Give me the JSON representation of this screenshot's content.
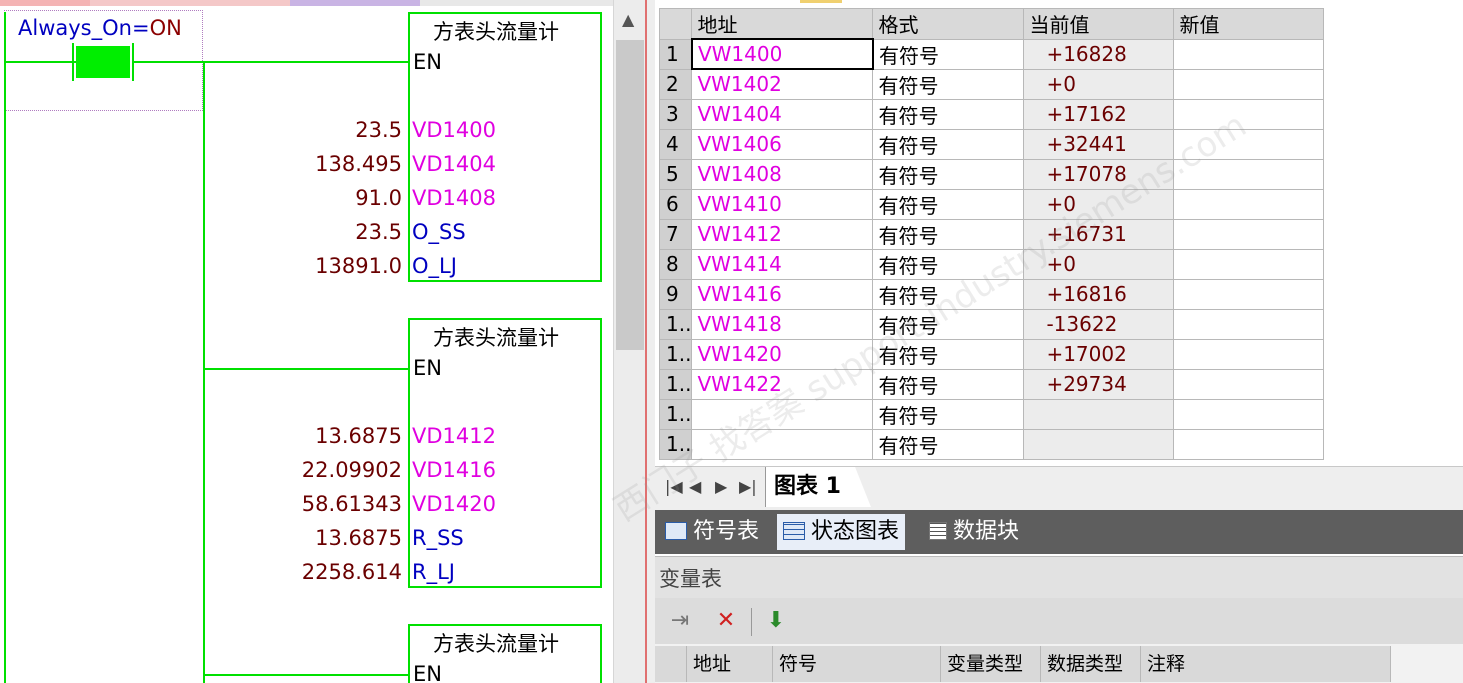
{
  "ladder": {
    "contact_name": "Always_On",
    "contact_eq": "=",
    "contact_state": "ON",
    "blocks": [
      {
        "title": "方表头流量计",
        "en": "EN",
        "pins": [
          {
            "value": "23.5",
            "name": "VD1400",
            "color": "magenta"
          },
          {
            "value": "138.495",
            "name": "VD1404",
            "color": "magenta"
          },
          {
            "value": "91.0",
            "name": "VD1408",
            "color": "magenta"
          },
          {
            "value": "23.5",
            "name": "O_SS",
            "color": "blue"
          },
          {
            "value": "13891.0",
            "name": "O_LJ",
            "color": "blue"
          }
        ]
      },
      {
        "title": "方表头流量计",
        "en": "EN",
        "pins": [
          {
            "value": "13.6875",
            "name": "VD1412",
            "color": "magenta"
          },
          {
            "value": "22.09902",
            "name": "VD1416",
            "color": "magenta"
          },
          {
            "value": "58.61343",
            "name": "VD1420",
            "color": "magenta"
          },
          {
            "value": "13.6875",
            "name": "R_SS",
            "color": "blue"
          },
          {
            "value": "2258.614",
            "name": "R_LJ",
            "color": "blue"
          }
        ]
      },
      {
        "title": "方表头流量计",
        "en": "EN",
        "pins": []
      }
    ]
  },
  "status_chart": {
    "headers": {
      "address": "地址",
      "format": "格式",
      "current": "当前值",
      "new": "新值"
    },
    "rows": [
      {
        "n": "1",
        "address": "VW1400",
        "format": "有符号",
        "current": "+16828"
      },
      {
        "n": "2",
        "address": "VW1402",
        "format": "有符号",
        "current": "+0"
      },
      {
        "n": "3",
        "address": "VW1404",
        "format": "有符号",
        "current": "+17162"
      },
      {
        "n": "4",
        "address": "VW1406",
        "format": "有符号",
        "current": "+32441"
      },
      {
        "n": "5",
        "address": "VW1408",
        "format": "有符号",
        "current": "+17078"
      },
      {
        "n": "6",
        "address": "VW1410",
        "format": "有符号",
        "current": "+0"
      },
      {
        "n": "7",
        "address": "VW1412",
        "format": "有符号",
        "current": "+16731"
      },
      {
        "n": "8",
        "address": "VW1414",
        "format": "有符号",
        "current": "+0"
      },
      {
        "n": "9",
        "address": "VW1416",
        "format": "有符号",
        "current": "+16816"
      },
      {
        "n": "1..",
        "address": "VW1418",
        "format": "有符号",
        "current": "-13622"
      },
      {
        "n": "1..",
        "address": "VW1420",
        "format": "有符号",
        "current": "+17002"
      },
      {
        "n": "1..",
        "address": "VW1422",
        "format": "有符号",
        "current": "+29734"
      },
      {
        "n": "1..",
        "address": "",
        "format": "有符号",
        "current": ""
      },
      {
        "n": "1..",
        "address": "",
        "format": "有符号",
        "current": ""
      }
    ],
    "sheet_tab": "图表 1",
    "nav_icons": [
      "first-icon",
      "prev-icon",
      "next-icon",
      "last-icon"
    ]
  },
  "view_tabs": [
    {
      "label": "符号表",
      "icon": "symbol-table-icon",
      "active": false
    },
    {
      "label": "状态图表",
      "icon": "status-chart-icon",
      "active": true
    },
    {
      "label": "数据块",
      "icon": "data-block-icon",
      "active": false
    }
  ],
  "variable_table": {
    "title": "变量表",
    "tools": [
      "insert-row-icon",
      "delete-row-icon",
      "download-icon"
    ],
    "headers": [
      "地址",
      "符号",
      "变量类型",
      "数据类型",
      "注释"
    ]
  },
  "watermark": "西门子 找答案 support.industry.siemens.com",
  "colors": {
    "wire": "#00e000",
    "magenta": "#e000e0",
    "blue": "#0000c0",
    "value": "#6a0000"
  }
}
